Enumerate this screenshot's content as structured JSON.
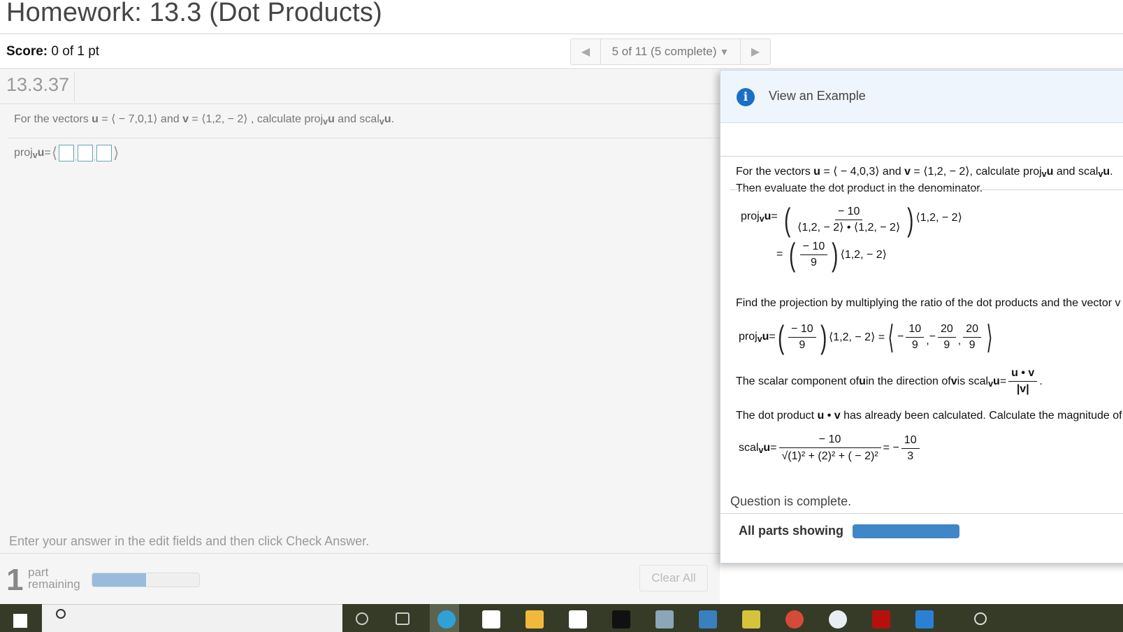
{
  "header": {
    "title": "Homework: 13.3 (Dot Products)"
  },
  "score": {
    "label": "Score:",
    "value": "0 of 1 pt"
  },
  "question_nav": {
    "prev_icon": "triangle-left-icon",
    "status": "5 of 11 (5 complete)",
    "dropdown_icon": "triangle-down-icon",
    "next_icon": "triangle-right-icon"
  },
  "question": {
    "number": "13.3.37",
    "prompt": {
      "lead": "For the vectors ",
      "u": "u",
      "u_eq": " = ⟨ − 7,0,1⟩ and ",
      "v": "v",
      "v_eq": " = ⟨1,2, − 2⟩ , calculate proj",
      "sub1": "v",
      "u2": "u",
      "and": " and scal",
      "sub2": "v",
      "u3": "u",
      "end": "."
    },
    "answer": {
      "label_proj": "proj",
      "label_sub": "v",
      "label_u": "u",
      "label_eq": " = ",
      "open": "⟨",
      "close": "⟩",
      "sep": ",",
      "fields": [
        "",
        "",
        ""
      ]
    },
    "instruction": "Enter your answer in the edit fields and then click Check Answer.",
    "parts_remaining": {
      "count": "1",
      "label_line1": "part",
      "label_line2": "remaining",
      "progress_percent": 50
    },
    "clear_all_label": "Clear All"
  },
  "example": {
    "title": "View an Example",
    "icon": "info-icon",
    "question": {
      "lead": "For the vectors ",
      "u": "u",
      "u_eq": " = ⟨ − 4,0,3⟩  and ",
      "v": "v",
      "v_eq": " = ⟨1,2, − 2⟩, calculate proj",
      "sub1": "v",
      "u2": "u",
      "and": " and scal",
      "sub2": "v",
      "u3": "u",
      "end": "."
    },
    "cut_text": "Then evaluate the dot product in the denominator.",
    "step1": {
      "lhs_proj": "proj",
      "lhs_sub": "v",
      "lhs_u": "u",
      "eq": " = ",
      "num": "− 10",
      "den": "⟨1,2, − 2⟩ • ⟨1,2, − 2⟩",
      "vec": "⟨1,2, − 2⟩"
    },
    "step2": {
      "eq": "=",
      "num": "− 10",
      "den": "9",
      "vec": "⟨1,2, − 2⟩"
    },
    "find_projection_text": "Find the projection by multiplying the ratio of the dot products and the vector v",
    "step3": {
      "lhs_proj": "proj",
      "lhs_sub": "v",
      "lhs_u": "u",
      "eq": " = ",
      "num": "− 10",
      "den": "9",
      "vec": "⟨1,2, − 2⟩ = ",
      "comp1_sign": "−",
      "comp1_num": "10",
      "comp1_den": "9",
      "comp2_sign": "−",
      "comp2_num": "20",
      "comp2_den": "9",
      "comp3_num": "20",
      "comp3_den": "9",
      "sep": ","
    },
    "scalar_text": {
      "lead": "The scalar component of ",
      "u": "u",
      "mid": " in the direction of ",
      "v": "v",
      "is": " is scal",
      "sub": "v",
      "u2": "u",
      "eq": " = ",
      "num": "u • v",
      "den": "|v|",
      "end": "."
    },
    "dot_text": {
      "lead": "The dot product ",
      "uv": "u • v",
      "rest": " has already been calculated. Calculate the magnitude of"
    },
    "step4": {
      "lhs_scal": "scal",
      "lhs_sub": "v",
      "lhs_u": "u",
      "eq": " = ",
      "num": "− 10",
      "den": "√(1)² + (2)² + ( − 2)²",
      "eq2": " = − ",
      "res_num": "10",
      "res_den": "3"
    },
    "complete_text": "Question is complete.",
    "all_parts_label": "All parts showing",
    "all_parts_progress_percent": 100
  },
  "taskbar": {
    "start_icon": "windows-start-icon",
    "search_icon": "search-icon",
    "icons": [
      "task-view-icon",
      "edge-browser-icon",
      "dropbox-icon",
      "folder-icon",
      "app-icon",
      "netflix-icon",
      "computer-icon",
      "app-icon",
      "app-icon",
      "chrome-icon",
      "app-icon",
      "app-icon",
      "app-icon",
      "app-icon"
    ]
  },
  "colors": {
    "accent_blue": "#3f87c6",
    "info_blue": "#1a6fc6",
    "progress_light": "#99bbdd",
    "taskbar": "#353b27"
  }
}
